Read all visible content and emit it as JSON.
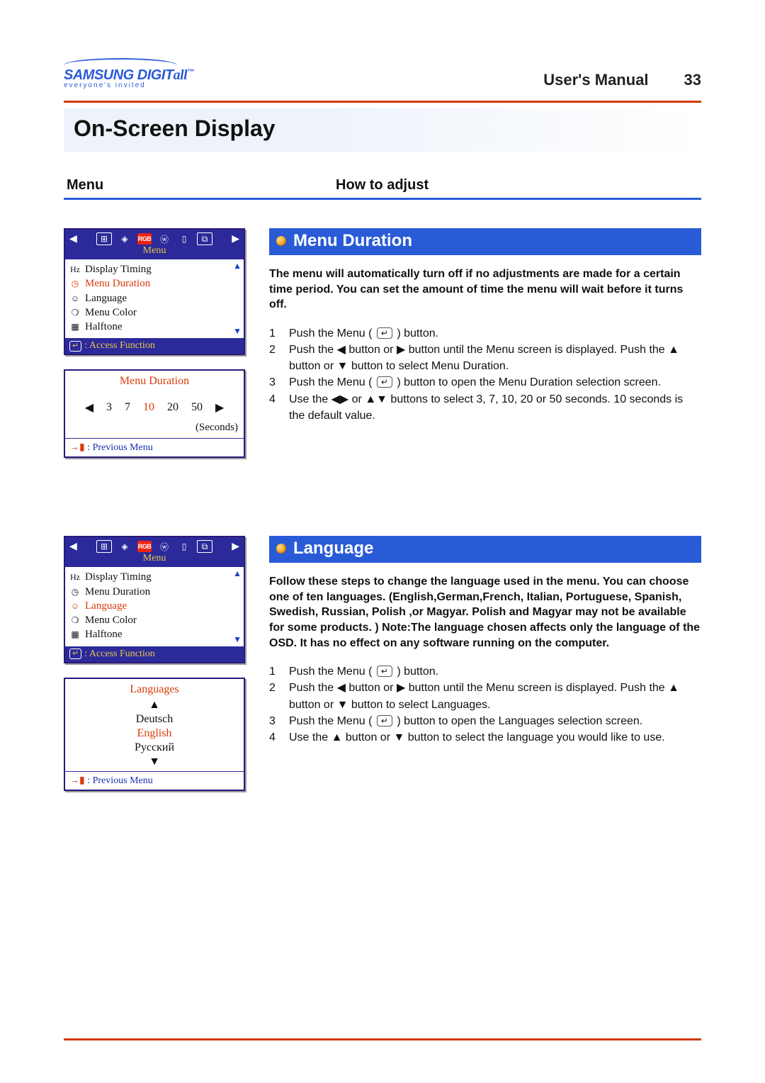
{
  "header": {
    "brand_main": "SAMSUNG DIGIT",
    "brand_suffix": "all",
    "brand_tm": "™",
    "brand_tag": "everyone's invited",
    "manual": "User's Manual",
    "page_number": "33"
  },
  "page_title": "On-Screen Display",
  "column_headers": {
    "left": "Menu",
    "right": "How to adjust"
  },
  "osd_common": {
    "menu_label": "Menu",
    "access_label": ": Access Function",
    "previous_label": ": Previous Menu",
    "enter_glyph": "↵",
    "exit_glyph": "→▮",
    "nav_left": "◀",
    "nav_right": "▶",
    "arrow_up": "▲",
    "arrow_down": "▼",
    "icons": [
      "⊞",
      "◈",
      "RGB",
      "ⓦ",
      "▯",
      "⧉"
    ]
  },
  "sections": [
    {
      "id": "menu_duration",
      "heading": "Menu Duration",
      "intro": "The menu will automatically turn off if no adjustments are made for a certain time period. You can set the amount of time the menu will wait before it turns off.",
      "menu_items": [
        {
          "icon": "Hz",
          "label": "Display Timing",
          "selected": false
        },
        {
          "icon": "◷",
          "label": "Menu Duration",
          "selected": true
        },
        {
          "icon": "☺",
          "label": "Language",
          "selected": false
        },
        {
          "icon": "❍",
          "label": "Menu Color",
          "selected": false
        },
        {
          "icon": "▦",
          "label": "Halftone",
          "selected": false
        }
      ],
      "panel": {
        "title": "Menu Duration",
        "values": [
          "3",
          "7",
          "10",
          "20",
          "50"
        ],
        "selected_index": 2,
        "unit": "(Seconds)"
      },
      "steps": [
        "Push the Menu ( ↵ ) button.",
        "Push the ◀ button or ▶ button until the Menu screen is displayed. Push the ▲ button or ▼ button to select Menu Duration.",
        "Push the Menu ( ↵ ) button to open the Menu Duration selection screen.",
        "Use the ◀▶ or ▲▼ buttons to select 3, 7, 10, 20 or 50 seconds. 10 seconds is the default value."
      ]
    },
    {
      "id": "language",
      "heading": "Language",
      "intro": "Follow these steps to change the language used in the menu. You can choose one of ten languages. (English,German,French, Italian, Portuguese, Spanish, Swedish, Russian, Polish ,or Magyar. Polish and Magyar may not be available for some products. ) Note:The language chosen affects only the language of the OSD. It has no effect on any software running on the computer.",
      "menu_items": [
        {
          "icon": "Hz",
          "label": "Display Timing",
          "selected": false
        },
        {
          "icon": "◷",
          "label": "Menu Duration",
          "selected": false
        },
        {
          "icon": "☺",
          "label": "Language",
          "selected": true
        },
        {
          "icon": "❍",
          "label": "Menu Color",
          "selected": false
        },
        {
          "icon": "▦",
          "label": "Halftone",
          "selected": false
        }
      ],
      "panel": {
        "title": "Languages",
        "options": [
          "Deutsch",
          "English",
          "Русский"
        ],
        "selected_index": 1
      },
      "steps": [
        "Push the Menu ( ↵ ) button.",
        "Push the ◀ button or ▶ button until the Menu screen is displayed. Push the ▲ button or ▼ button to select Languages.",
        "Push the Menu ( ↵ ) button to open the Languages selection screen.",
        "Use the ▲ button or  ▼ button to select the language you would like to use."
      ]
    }
  ]
}
